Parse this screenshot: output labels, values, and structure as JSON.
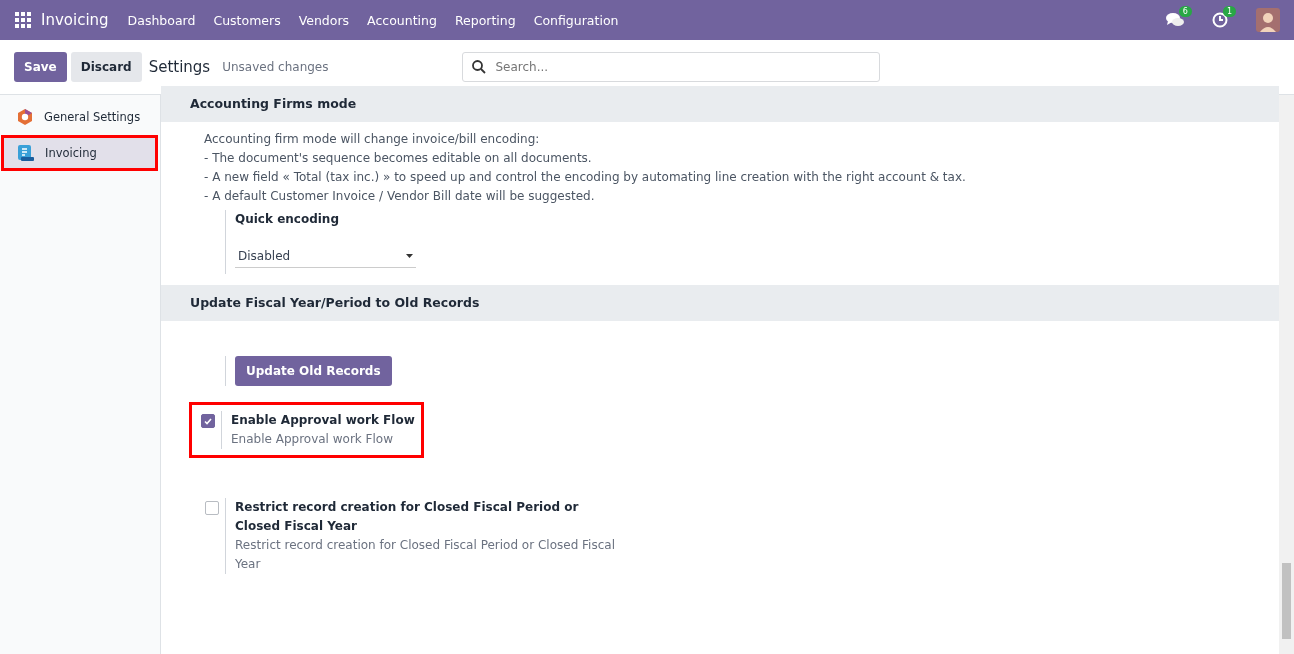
{
  "navbar": {
    "app": "Invoicing",
    "menu": [
      "Dashboard",
      "Customers",
      "Vendors",
      "Accounting",
      "Reporting",
      "Configuration"
    ],
    "messages_count": "6",
    "activities_count": "1"
  },
  "control_panel": {
    "save": "Save",
    "discard": "Discard",
    "title": "Settings",
    "status": "Unsaved changes",
    "search": {
      "placeholder": "Search..."
    }
  },
  "sidebar": {
    "items": [
      {
        "label": "General Settings",
        "selected": false,
        "highlighted": false,
        "kind": "general"
      },
      {
        "label": "Invoicing",
        "selected": true,
        "highlighted": true,
        "kind": "invoicing"
      }
    ]
  },
  "sections": [
    {
      "title": "Accounting Firms mode",
      "description": [
        "Accounting firm mode will change invoice/bill encoding:",
        "- The document's sequence becomes editable on all documents.",
        "- A new field « Total (tax inc.) » to speed up and control the encoding by automating line creation with the right account & tax.",
        "- A default Customer Invoice / Vendor Bill date will be suggested."
      ],
      "settings": [
        {
          "kind": "select",
          "label": "Quick encoding",
          "value": "Disabled"
        }
      ]
    },
    {
      "title": "Update Fiscal Year/Period to Old Records",
      "settings": [
        {
          "kind": "button",
          "label": "Update Old Records"
        },
        {
          "kind": "checkbox",
          "label": "Enable Approval work Flow",
          "help": "Enable Approval work Flow",
          "checked": true,
          "highlighted": true
        },
        {
          "kind": "checkbox",
          "label": "Restrict record creation for Closed Fiscal Period or Closed Fiscal Year",
          "help": "Restrict record creation for Closed Fiscal Period or Closed Fiscal Year",
          "checked": false,
          "highlighted": false
        }
      ]
    }
  ]
}
